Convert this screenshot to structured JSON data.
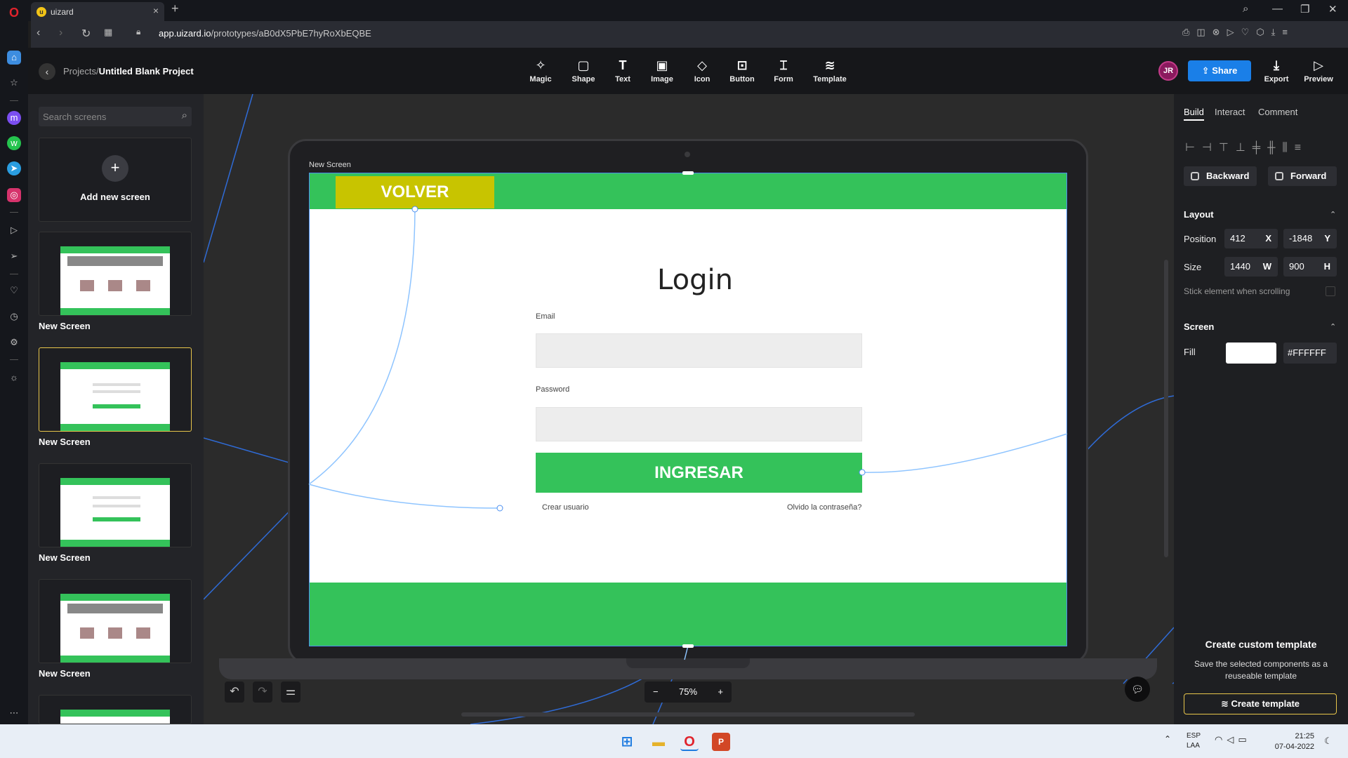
{
  "browser": {
    "tab_title": "uizard",
    "tab_close": "×",
    "new_tab": "+",
    "url_domain": "app.uizard.io",
    "url_path": "/prototypes/aB0dX5PbE7hyRoXbEQBE"
  },
  "project": {
    "breadcrumb_parent": "Projects",
    "breadcrumb_sep": "/",
    "breadcrumb_current": "Untitled Blank Project"
  },
  "toolbar": {
    "tools": [
      "Magic",
      "Shape",
      "Text",
      "Image",
      "Icon",
      "Button",
      "Form",
      "Template"
    ],
    "avatar_initials": "JR",
    "share_label": "Share",
    "export_label": "Export",
    "preview_label": "Preview"
  },
  "screens_panel": {
    "search_placeholder": "Search screens",
    "add_new_label": "Add new screen",
    "screens": [
      "New Screen",
      "New Screen",
      "New Screen",
      "New Screen"
    ]
  },
  "canvas": {
    "screen_label": "New Screen",
    "volver": "VOLVER",
    "login_title": "Login",
    "email_label": "Email",
    "password_label": "Password",
    "submit_label": "INGRESAR",
    "crear_usuario": "Crear usuario",
    "olvido": "Olvido la contraseña?",
    "zoom": "75%",
    "zoom_out": "−",
    "zoom_in": "+",
    "green": "#34C25A",
    "yellow": "#C8C400"
  },
  "inspector": {
    "tabs": [
      "Build",
      "Interact",
      "Comment"
    ],
    "backward_label": "Backward",
    "forward_label": "Forward",
    "layout_title": "Layout",
    "position_label": "Position",
    "pos_x": "412",
    "pos_x_unit": "X",
    "pos_y": "-1848",
    "pos_y_unit": "Y",
    "size_label": "Size",
    "size_w": "1440",
    "size_w_unit": "W",
    "size_h": "900",
    "size_h_unit": "H",
    "stick_label": "Stick element when scrolling",
    "screen_title": "Screen",
    "fill_label": "Fill",
    "fill_hex": "#FFFFFF",
    "custom_template_title": "Create custom template",
    "custom_template_desc": "Save the selected components as a reuseable template",
    "create_template_button": "Create template"
  },
  "taskbar": {
    "lang_top": "ESP",
    "lang_bottom": "LAA",
    "time": "21:25",
    "date": "07-04-2022"
  }
}
